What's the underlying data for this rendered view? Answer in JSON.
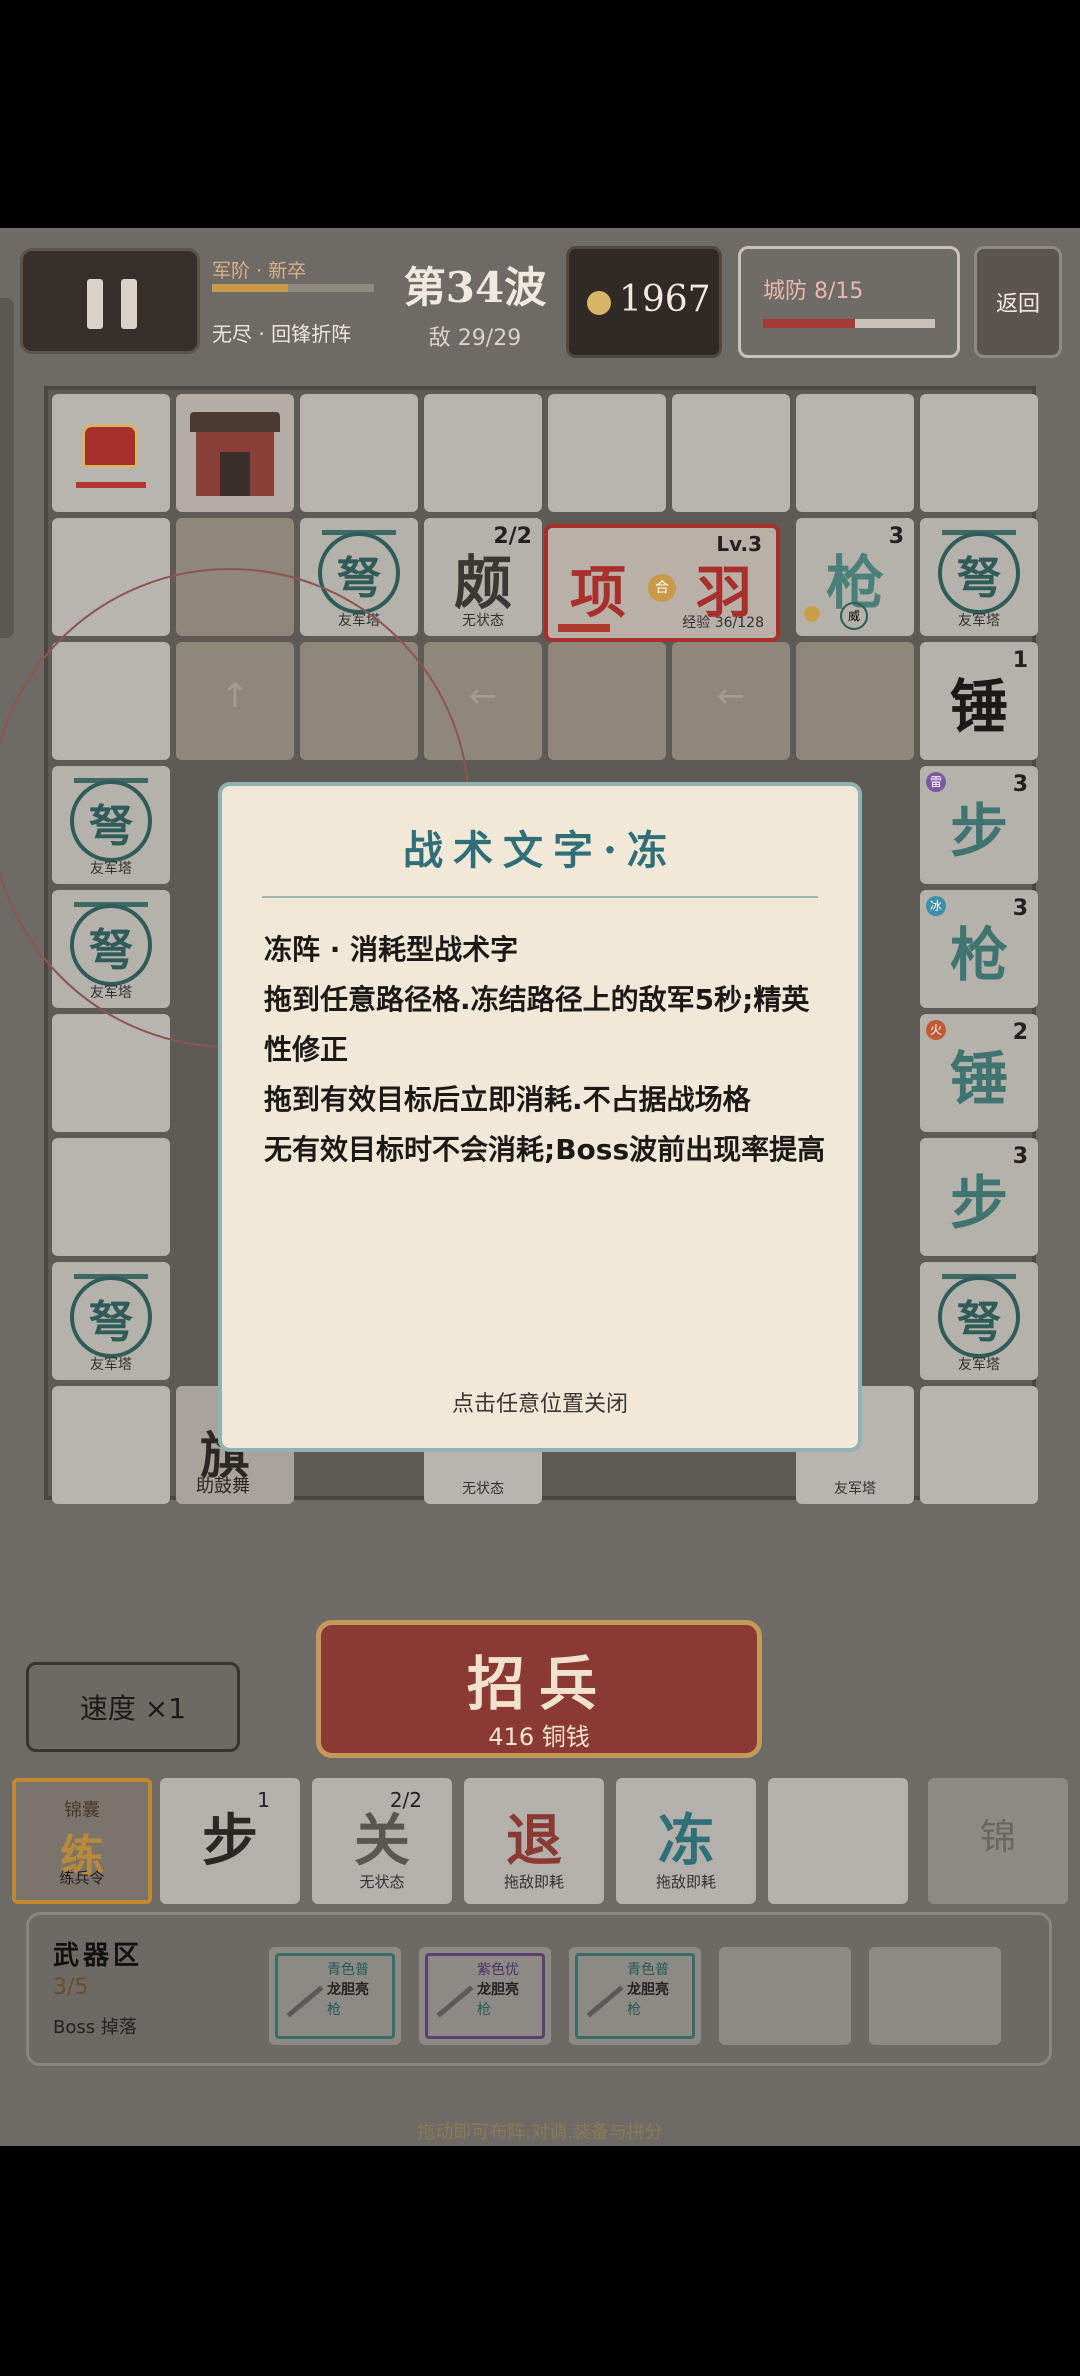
{
  "topbar": {
    "rank_label": "军阶 · 新卒",
    "rank_progress": 0.47,
    "mode_label": "无尽 · 回锋折阵",
    "wave_title": "第34波",
    "enemy_count": "敌 29/29",
    "coins": "1967",
    "defense_label": "城防 8/15",
    "defense_ratio": 0.533,
    "return_label": "返回"
  },
  "board": {
    "boss": {
      "glyph1": "项",
      "glyph2": "羽",
      "glyph_mid": "合",
      "level": "Lv.3",
      "xp": "经验 36/128"
    },
    "cells": {
      "tower_label": "友军塔",
      "tower_glyph": "弩",
      "hammer": {
        "glyph": "锤",
        "level": "1"
      },
      "spear": {
        "glyph": "枪",
        "level": "3"
      },
      "frequency": {
        "glyph": "颇",
        "level": "2/2",
        "sub": "无状态"
      },
      "step_right": {
        "glyph": "步",
        "level": "3"
      },
      "spear_ice": {
        "glyph": "枪",
        "level": "3",
        "chip": "冰"
      },
      "hammer_fire": {
        "glyph": "锤",
        "level": "2",
        "chip": "火"
      },
      "step_right2": {
        "glyph": "步",
        "level": "3"
      },
      "bottom_sub": "无状态",
      "weiChip": "威",
      "banner_text": "旗",
      "banner_sub": "助鼓舞"
    },
    "arrows": [
      "↑",
      "←",
      "←"
    ]
  },
  "controls": {
    "recruit_title": "招兵",
    "recruit_cost": "416 铜钱",
    "speed_label": "速度 ×1"
  },
  "hand": [
    {
      "top": "锦囊",
      "glyph": "练",
      "sub": "练兵令"
    },
    {
      "glyph": "步",
      "level": "1",
      "sub": ""
    },
    {
      "glyph": "关",
      "level": "2/2",
      "sub": "无状态"
    },
    {
      "glyph": "退",
      "sub": "拖敌即耗"
    },
    {
      "glyph": "冻",
      "sub": "拖敌即耗"
    },
    {
      "glyph": "",
      "sub": ""
    },
    {
      "glyph": "锦",
      "sub": ""
    }
  ],
  "weapons": {
    "title": "武器区",
    "count": "3/5",
    "drop": "Boss 掉落",
    "items": [
      {
        "quality": "青色普",
        "name": "龙胆亮",
        "type": "枪"
      },
      {
        "quality": "紫色优",
        "name": "龙胆亮",
        "type": "枪"
      },
      {
        "quality": "青色普",
        "name": "龙胆亮",
        "type": "枪"
      }
    ]
  },
  "bottom_hint": "拖动即可布阵.对调.装备与拼分",
  "modal": {
    "title": "战术文字·冻",
    "lines": [
      "冻阵 · 消耗型战术字",
      "拖到任意路径格.冻结路径上的敌军5秒;精英",
      "性修正",
      "拖到有效目标后立即消耗.不占据战场格",
      "无有效目标时不会消耗;Boss波前出现率提高"
    ],
    "close_hint": "点击任意位置关闭"
  },
  "colors": {
    "accent_red": "#a8302c",
    "accent_teal": "#2f6f78",
    "gold": "#d8b466"
  }
}
